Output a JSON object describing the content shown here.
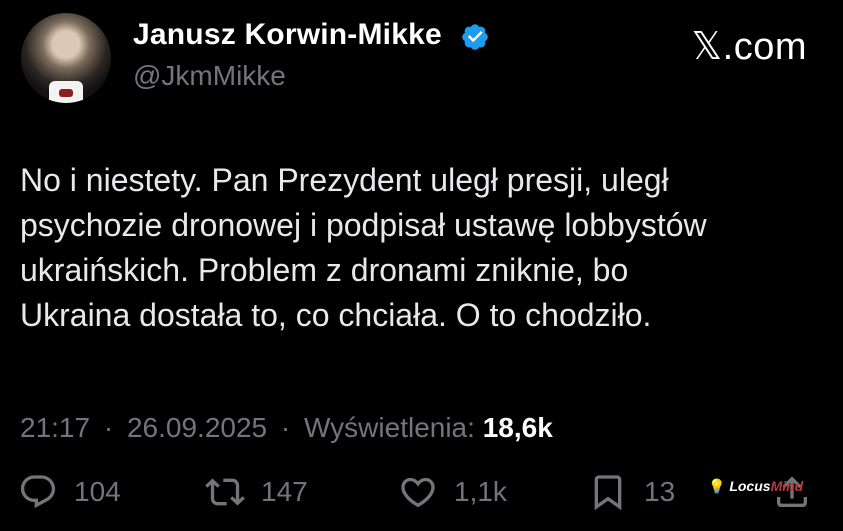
{
  "author": {
    "name": "Janusz Korwin-Mikke",
    "handle": "@JkmMikke",
    "verified": true
  },
  "brand": "𝕏.com",
  "tweet": {
    "lines": [
      "No i niestety. Pan Prezydent uległ presji, uległ",
      "psychozie dronowej i podpisał ustawę lobbystów",
      "ukraińskich. Problem z dronami zniknie, bo",
      "Ukraina dostała to, co chciała. O to chodziło."
    ]
  },
  "meta": {
    "time": "21:17",
    "date": "26.09.2025",
    "views_label": "Wyświetlenia:",
    "views_count": "18,6k",
    "separator": "·"
  },
  "actions": {
    "replies": "104",
    "reposts": "147",
    "likes": "1,1k",
    "bookmarks": "13"
  },
  "watermark": {
    "locus": "Locus",
    "mind": "Mind"
  },
  "colors": {
    "background": "#000000",
    "text": "#e7e9ea",
    "muted": "#71767b",
    "verified": "#1d9bf0"
  }
}
